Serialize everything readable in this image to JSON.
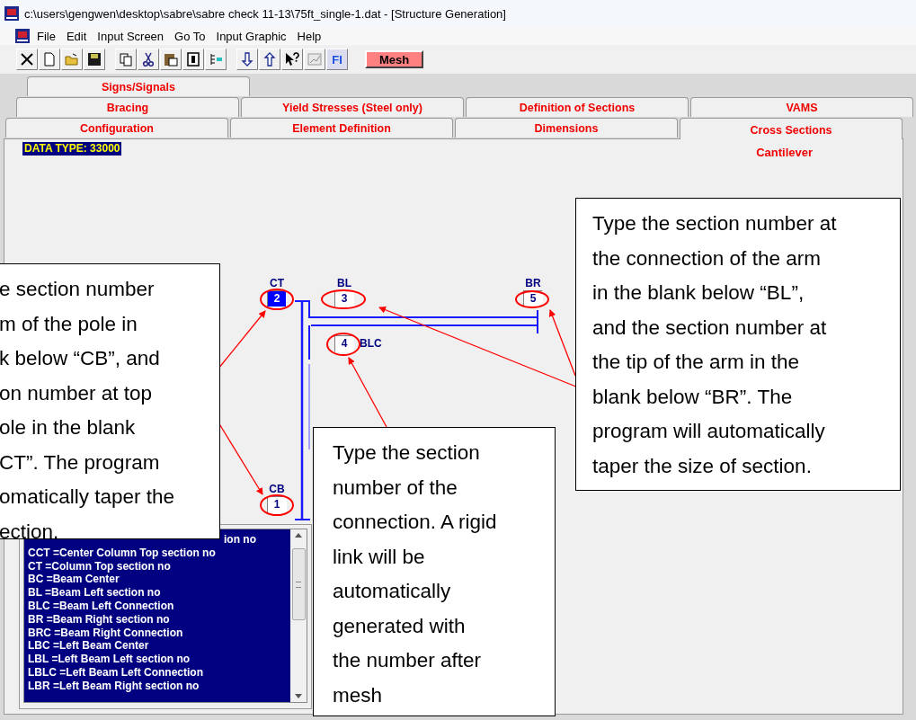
{
  "window": {
    "title": "c:\\users\\gengwen\\desktop\\sabre\\sabre check 11-13\\75ft_single-1.dat - [Structure Generation]"
  },
  "menu": [
    {
      "label": "File"
    },
    {
      "label": "Edit"
    },
    {
      "label": "Input Screen"
    },
    {
      "label": "Go To"
    },
    {
      "label": "Input Graphic"
    },
    {
      "label": "Help"
    }
  ],
  "toolbar": [
    {
      "kind": "close"
    },
    {
      "kind": "new"
    },
    {
      "kind": "open"
    },
    {
      "kind": "save"
    },
    {
      "kind": "gap"
    },
    {
      "kind": "copy"
    },
    {
      "kind": "cut"
    },
    {
      "kind": "paste"
    },
    {
      "kind": "delete"
    },
    {
      "kind": "tree"
    },
    {
      "kind": "gap"
    },
    {
      "kind": "down"
    },
    {
      "kind": "up"
    },
    {
      "kind": "help"
    },
    {
      "kind": "chart"
    },
    {
      "kind": "text",
      "label": "FI"
    },
    {
      "kind": "gap"
    },
    {
      "kind": "mesh",
      "label": "Mesh"
    }
  ],
  "tabs": [
    [
      {
        "label": "Signs/Signals",
        "selected": false
      }
    ],
    [
      {
        "label": "Bracing",
        "selected": false
      },
      {
        "label": "Yield Stresses (Steel only)",
        "selected": false
      },
      {
        "label": "Definition of Sections",
        "selected": false
      },
      {
        "label": "VAMS",
        "selected": false
      }
    ],
    [
      {
        "label": "Configuration",
        "selected": false
      },
      {
        "label": "Element Definition",
        "selected": false
      },
      {
        "label": "Dimensions",
        "selected": false
      },
      {
        "label": "Cross Sections",
        "selected": true
      }
    ]
  ],
  "data_type": "DATA TYPE: 33000",
  "panel_title": "Cantilever",
  "fields": [
    {
      "label": "CT",
      "value": "2",
      "kind": "top",
      "selected": true
    },
    {
      "label": "BL",
      "value": "3",
      "kind": "top",
      "selected": false
    },
    {
      "label": "BR",
      "value": "5",
      "kind": "top",
      "selected": false
    },
    {
      "label": "BLC",
      "value": "4",
      "kind": "side",
      "selected": false
    },
    {
      "label": "CB",
      "value": "1",
      "kind": "top",
      "selected": false
    }
  ],
  "legend": [
    {
      "text": "ion no",
      "kind": "partial"
    },
    {
      "text": "CCT =Center Column Top section no",
      "kind": "full"
    },
    {
      "text": "CT =Column Top section no",
      "kind": "full"
    },
    {
      "text": "BC =Beam Center",
      "kind": "full"
    },
    {
      "text": "BL =Beam Left section no",
      "kind": "full"
    },
    {
      "text": "BLC =Beam Left Connection",
      "kind": "full"
    },
    {
      "text": "BR =Beam Right section no",
      "kind": "full"
    },
    {
      "text": "BRC =Beam Right Connection",
      "kind": "full"
    },
    {
      "text": "LBC =Left Beam Center",
      "kind": "full"
    },
    {
      "text": "LBL =Left Beam Left section no",
      "kind": "full"
    },
    {
      "text": "LBLC =Left Beam Left Connection",
      "kind": "full"
    },
    {
      "text": "LBR =Left Beam Right section no",
      "kind": "full"
    }
  ],
  "callouts": [
    {
      "kind": "left",
      "text": "e section number\nm of the pole in\nk below “CB”, and\non number at top\nole in the blank\nCT”.  The program\nomatically taper the\nection."
    },
    {
      "kind": "middle",
      "text": "Type the section\nnumber of the\nconnection. A rigid\nlink will be\nautomatically\ngenerated with\nthe number after\nmesh"
    },
    {
      "kind": "right",
      "text": "Type the section number at\nthe connection of the arm\nin the blank below “BL”,\nand the section number at\nthe tip of the arm in the\nblank below “BR”.  The\nprogram will automatically\ntaper the size of section."
    }
  ]
}
